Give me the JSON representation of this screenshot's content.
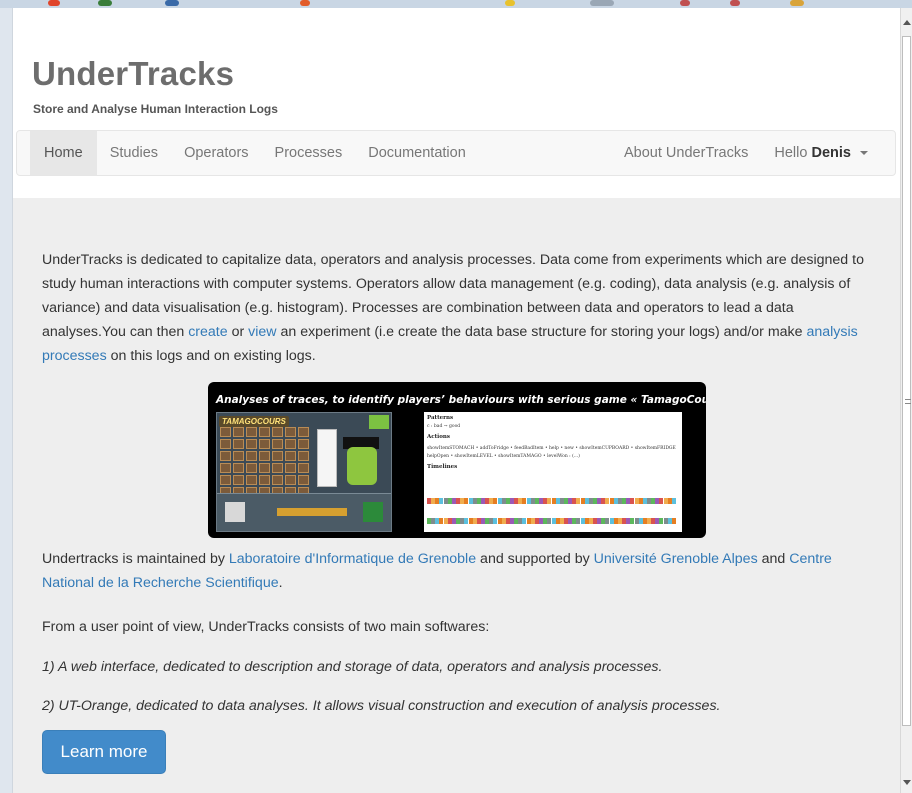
{
  "header": {
    "brand": "UnderTracks",
    "tagline": "Store and Analyse Human Interaction Logs"
  },
  "nav": {
    "left": [
      {
        "label": "Home",
        "active": true
      },
      {
        "label": "Studies"
      },
      {
        "label": "Operators"
      },
      {
        "label": "Processes"
      },
      {
        "label": "Documentation"
      }
    ],
    "about": "About UnderTracks",
    "greeting": "Hello",
    "user": "Denis"
  },
  "intro": {
    "part1": "UnderTracks is dedicated to capitalize data, operators and analysis processes. Data come from experiments which are designed to study human interactions with computer systems. Operators allow data management (e.g. coding), data analysis (e.g. analysis of variance) and data visualisation (e.g. histogram). Processes are combination between data and operators to lead a data analyses.You can then ",
    "link_create": "create",
    "part2": " or ",
    "link_view": "view",
    "part3": " an experiment (i.e create the data base structure for storing your logs) and/or make ",
    "link_processes": "analysis processes",
    "part4": " on this logs and on existing logs."
  },
  "hero": {
    "title": "Analyses of traces, to identify players’ behaviours with serious game « TamagoCours »",
    "game_logo": "TAMAGOCOURS",
    "patterns_label": "Patterns",
    "patterns_text": "c : bad → good",
    "actions_label": "Actions",
    "actions_line1": "showItemSTOMACH • addToFridge • feedBadItem • help • new • showItemCUPBOARD • showItemFRIDGE",
    "actions_line2": "helpOpen • showItemLEVEL • showItemTAMAGO • levelWon : (...)",
    "timelines_label": "Timelines"
  },
  "maintained": {
    "part1": "Undertracks is maintained by ",
    "link_lig": "Laboratoire d'Informatique de Grenoble",
    "part2": " and supported by ",
    "link_uga": "Université Grenoble Alpes",
    "part3": " and ",
    "link_cnrs": "Centre National de la Recherche Scientifique",
    "part4": "."
  },
  "softwares": {
    "intro": "From a user point of view, UnderTracks consists of two main softwares:",
    "item1": "1) A web interface, dedicated to description and storage of data, operators and analysis processes.",
    "item2": "2) UT-Orange, dedicated to data analyses. It allows visual construction and execution of analysis processes."
  },
  "learn_more": "Learn more",
  "colors": {
    "link": "#337ab7",
    "button": "#428bca",
    "brand": "#6d6d6d",
    "jumbotron": "#eeeeee"
  }
}
